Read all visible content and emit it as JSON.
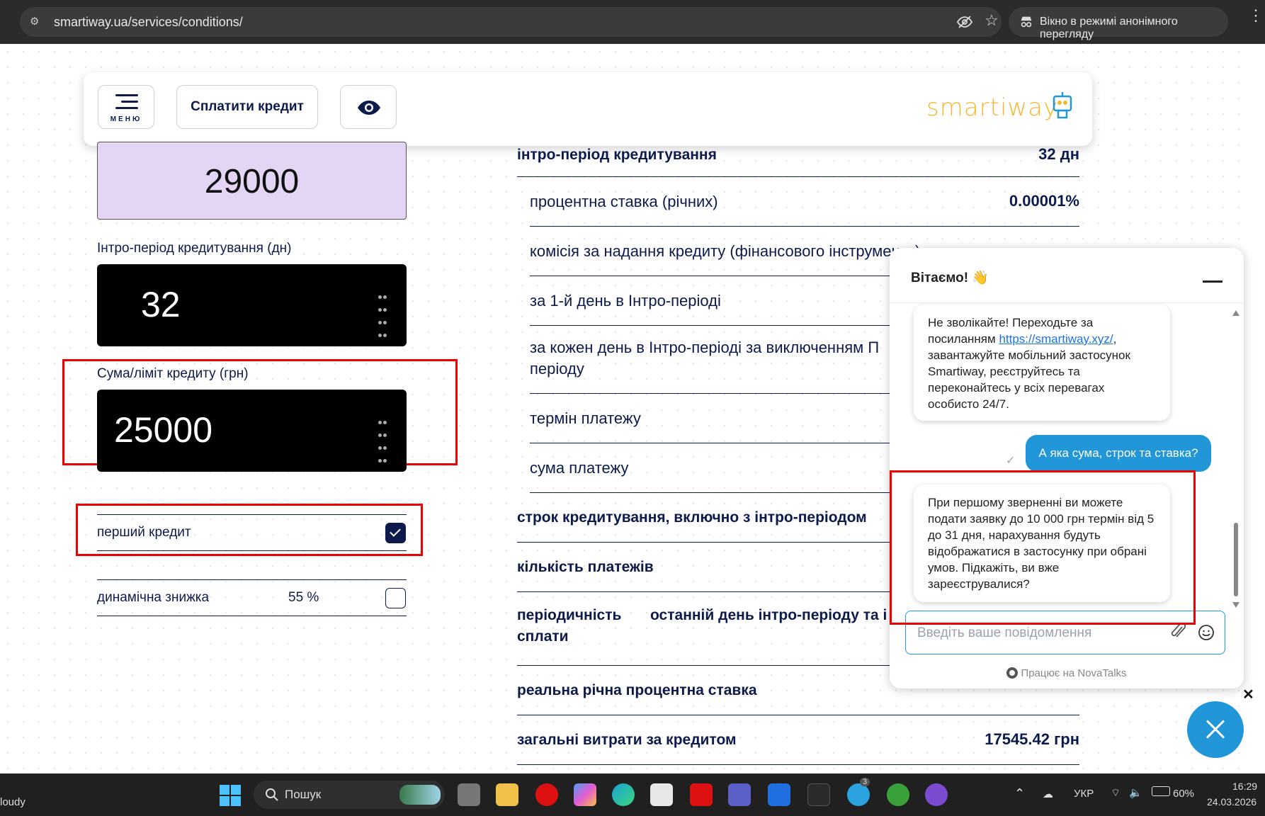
{
  "browser": {
    "url": "smartiway.ua/services/conditions/",
    "incognito_label": "Вікно в режимі анонімного перегляду"
  },
  "header": {
    "menu_label": "МЕНЮ",
    "pay_label": "Сплатити кредит",
    "logo": "smartiway"
  },
  "form": {
    "total_value": "29000",
    "intro_label": "Інтро-період кредитування (дн)",
    "intro_value": "32",
    "limit_label": "Сума/ліміт кредиту (грн)",
    "limit_value": "25000",
    "first_credit_label": "перший кредит",
    "first_credit_checked": true,
    "discount_label": "динамічна знижка",
    "discount_value": "55 %",
    "discount_checked": false
  },
  "table": {
    "rows": [
      {
        "label": "інтро-період кредитування",
        "value": "32 дн"
      },
      {
        "label": "процентна ставка (річних)",
        "value": "0.00001%"
      },
      {
        "label": "комісія за надання кредиту (фінансового інструменту)",
        "value": ""
      },
      {
        "label": "за 1-й день в Інтро-періоді",
        "value": ""
      },
      {
        "label": "за кожен день в Інтро-періоді за виключенням П",
        "label2": "періоду",
        "value": ""
      },
      {
        "label": "термін платежу",
        "value": ""
      },
      {
        "label": "сума платежу",
        "value": ""
      },
      {
        "label": "строк кредитування, включно з інтро-періодом",
        "value": ""
      },
      {
        "label": "кількість платежів",
        "value": ""
      },
      {
        "label": "періодичність",
        "label2": "сплати",
        "label3": "останній день інтро-періоду та і",
        "value": ""
      },
      {
        "label": "реальна річна процентна ставка",
        "value": ""
      },
      {
        "label": "загальні витрати за кредитом",
        "value": "17545.42 грн"
      }
    ]
  },
  "chat": {
    "title": "Вітаємо! 👋",
    "msg1_a": "Не зволікайте! Переходьте за посиланням ",
    "msg1_link": "https://smartiway.xyz/",
    "msg1_b": ", завантажуйте мобільний застосунок Smartiway, реєструйтесь та переконайтесь у всіх перевагах особисто 24/7.",
    "msg_user": "А яка сума, строк та ставка?",
    "msg2": "При першому зверненні ви можете подати заявку до 10 000 грн термін від 5 до 31 дня, нарахування будуть відображатися в застосунку при обрані умов. Підкажіть, ви вже зареєструвалися?",
    "input_placeholder": "Введіть ваше повідомлення",
    "powered": "Працює на NovaTalks"
  },
  "taskbar": {
    "weather": "loudy",
    "search_label": "Пошук",
    "lang": "УКР",
    "battery": "60%",
    "time": "16:29",
    "date": "24.03.2026",
    "telegram_badge": "3"
  },
  "colors": {
    "brand_navy": "#0d1b4c",
    "accent_blue": "#2196d8",
    "logo_yellow": "#f5b731",
    "highlight_red": "#e00000",
    "amount_lilac": "#e4d5f5"
  }
}
